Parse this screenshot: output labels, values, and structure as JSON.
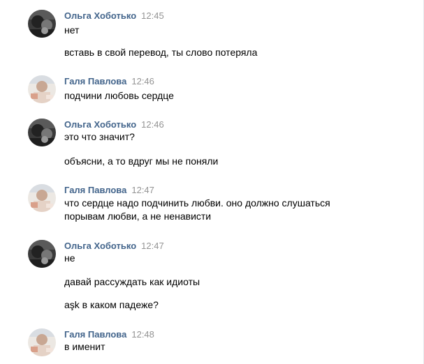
{
  "messages": [
    {
      "author": "Ольга Хоботько",
      "time": "12:45",
      "avatar": "avatar-olga",
      "lines": [
        "нет",
        "вставь в свой перевод, ты слово потеряла"
      ]
    },
    {
      "author": "Галя Павлова",
      "time": "12:46",
      "avatar": "avatar-galya",
      "lines": [
        "подчини любовь сердце"
      ]
    },
    {
      "author": "Ольга Хоботько",
      "time": "12:46",
      "avatar": "avatar-olga",
      "lines": [
        "это что значит?",
        "объясни, а то вдруг мы не поняли"
      ]
    },
    {
      "author": "Галя Павлова",
      "time": "12:47",
      "avatar": "avatar-galya",
      "lines": [
        "что сердце надо подчинить любви. оно должно слушаться",
        "порывам любви, а не ненависти"
      ]
    },
    {
      "author": "Ольга Хоботько",
      "time": "12:47",
      "avatar": "avatar-olga",
      "lines": [
        "не",
        "давай рассуждать как идиоты",
        "aşk в каком падеже?"
      ]
    },
    {
      "author": "Галя Павлова",
      "time": "12:48",
      "avatar": "avatar-galya",
      "lines": [
        "в именит"
      ]
    }
  ],
  "colors": {
    "author": "#42648b",
    "time": "#939393",
    "text": "#000000"
  }
}
